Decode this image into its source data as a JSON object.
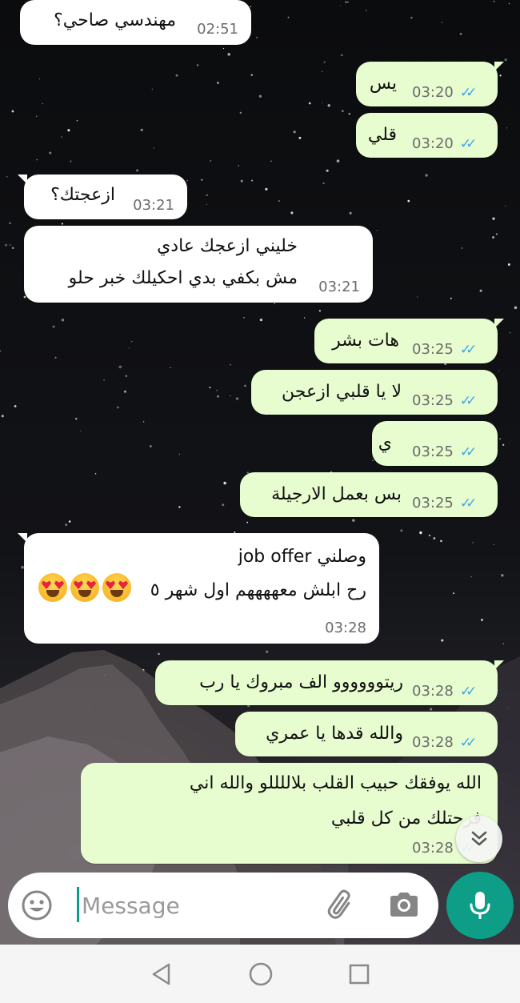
{
  "messages": [
    {
      "dir": "in",
      "lines": [
        "مهندسي صاحي؟"
      ],
      "time": "02:51"
    },
    {
      "dir": "out",
      "lines": [
        "يس"
      ],
      "time": "03:20"
    },
    {
      "dir": "out",
      "lines": [
        "قلي"
      ],
      "time": "03:20"
    },
    {
      "dir": "in",
      "lines": [
        "ازعجتك؟"
      ],
      "time": "03:21"
    },
    {
      "dir": "in",
      "lines": [
        "خليني ازعجك عادي",
        "مش بكفي بدي احكيلك خبر حلو"
      ],
      "time": "03:21"
    },
    {
      "dir": "out",
      "lines": [
        "هات بشر"
      ],
      "time": "03:25"
    },
    {
      "dir": "out",
      "lines": [
        "لا يا قلبي ازعجن"
      ],
      "time": "03:25"
    },
    {
      "dir": "out",
      "lines": [
        "ي"
      ],
      "time": "03:25"
    },
    {
      "dir": "out",
      "lines": [
        "بس بعمل الارجيلة"
      ],
      "time": "03:25"
    },
    {
      "dir": "in",
      "lines": [
        "وصلني  job offer",
        "رح ابلش معههههم اول شهر ٥"
      ],
      "emoji_count": 3,
      "emoji_name": "heart-eyes-emoji",
      "time": "03:28"
    },
    {
      "dir": "out",
      "lines": [
        "ريتوووووو الف مبروك يا رب"
      ],
      "time": "03:28"
    },
    {
      "dir": "out",
      "lines": [
        "والله قدها يا عمري"
      ],
      "time": "03:28"
    },
    {
      "dir": "out",
      "lines": [
        "الله يوفقك حبيب القلب بلاللللو والله اني",
        "فرحتلك من كل قلبي"
      ],
      "time": "03:28"
    }
  ],
  "composer": {
    "placeholder": "Message",
    "value": ""
  },
  "icons": {
    "emoji": "emoji-icon",
    "attach": "paperclip-icon",
    "camera": "camera-icon",
    "mic": "microphone-icon",
    "scroll": "double-chevron-down-icon",
    "read": "double-check-icon",
    "nav_back": "back-triangle-icon",
    "nav_home": "home-circle-icon",
    "nav_recents": "recents-square-icon"
  },
  "colors": {
    "incoming_bubble": "#ffffff",
    "outgoing_bubble": "#e7fccf",
    "accent": "#0e9e88",
    "read_ticks": "#3ea6e8"
  }
}
